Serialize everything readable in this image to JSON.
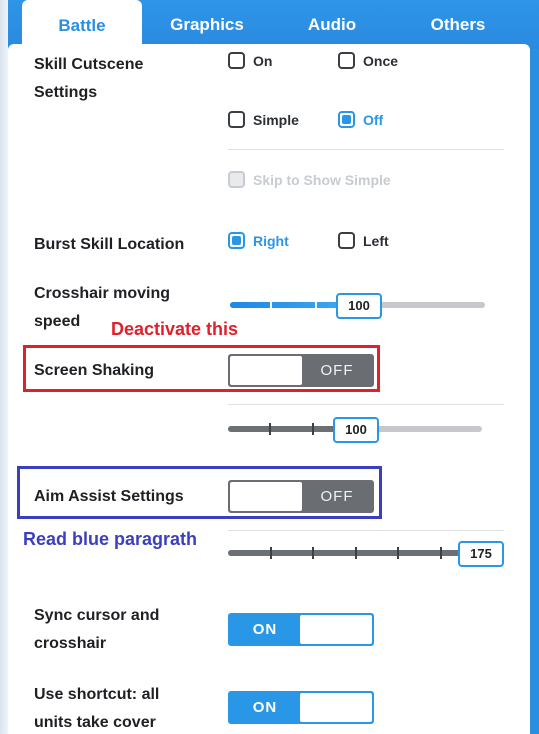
{
  "tabs": [
    {
      "label": "Battle",
      "active": true
    },
    {
      "label": "Graphics",
      "active": false
    },
    {
      "label": "Audio",
      "active": false
    },
    {
      "label": "Others",
      "active": false
    }
  ],
  "skill_cutscene": {
    "label_line1": "Skill Cutscene",
    "label_line2": "Settings",
    "options": [
      {
        "label": "On",
        "checked": false
      },
      {
        "label": "Once",
        "checked": false
      },
      {
        "label": "Simple",
        "checked": false
      },
      {
        "label": "Off",
        "checked": true
      }
    ],
    "skip_option": {
      "label": "Skip to Show Simple",
      "checked": false,
      "disabled": true
    }
  },
  "burst_skill": {
    "label": "Burst Skill Location",
    "options": [
      {
        "label": "Right",
        "checked": true
      },
      {
        "label": "Left",
        "checked": false
      }
    ]
  },
  "crosshair_speed": {
    "label_line1": "Crosshair moving",
    "label_line2": "speed",
    "value": "100",
    "fill_fraction": 0.41
  },
  "screen_shaking": {
    "label": "Screen Shaking",
    "toggle": "OFF",
    "slider_value": "100",
    "slider_fraction": 0.41
  },
  "aim_assist": {
    "label": "Aim Assist Settings",
    "toggle": "OFF",
    "slider_value": "175",
    "slider_fraction": 0.92
  },
  "sync_cursor": {
    "label_line1": "Sync cursor and",
    "label_line2": "crosshair",
    "toggle": "ON"
  },
  "use_shortcut": {
    "label_line1": "Use shortcut: all",
    "label_line2": "units take cover",
    "toggle": "ON"
  },
  "annotations": {
    "red_text": "Deactivate this",
    "blue_text": "Read blue paragrath",
    "red_color": "#e0202a",
    "blue_color": "#3b3fbf"
  },
  "colors": {
    "accent": "#2a96e6",
    "tab_bar": "#2b8fe0",
    "toggle_off": "#6a6d72"
  }
}
